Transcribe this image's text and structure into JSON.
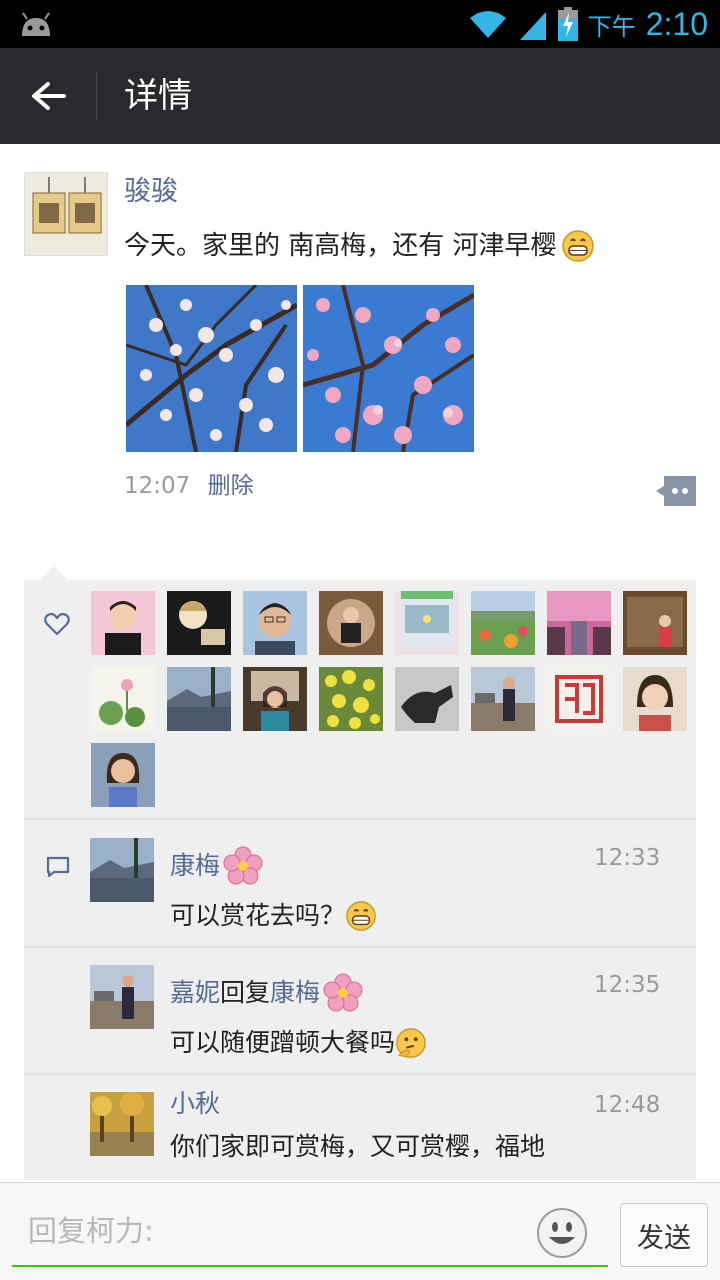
{
  "status_bar": {
    "ampm": "下午",
    "time": "2:10",
    "icons": [
      "android-icon",
      "wifi-icon",
      "signal-icon",
      "battery-charging-icon"
    ]
  },
  "action_bar": {
    "title": "详情",
    "back_icon": "arrow-left-icon"
  },
  "post": {
    "author": "骏骏",
    "text": "今天。家里的 南高梅，还有 河津早樱",
    "text_emoji": "grin-emoji",
    "time": "12:07",
    "delete_label": "删除",
    "photos": [
      "plum-blossom-photo",
      "cherry-blossom-photo"
    ],
    "comment_icon": "comment-dots-icon"
  },
  "likes": {
    "icon": "heart-icon",
    "avatars": [
      "avatar-1",
      "avatar-2",
      "avatar-3",
      "avatar-4",
      "avatar-5",
      "avatar-6",
      "avatar-7",
      "avatar-8",
      "avatar-9",
      "avatar-10",
      "avatar-11",
      "avatar-12",
      "avatar-13",
      "avatar-14",
      "avatar-15",
      "avatar-16",
      "avatar-17"
    ]
  },
  "comments": [
    {
      "name": "康梅",
      "name_emoji": "flower-emoji",
      "time": "12:33",
      "text": "可以赏花去吗？",
      "text_emoji": "grin-emoji"
    },
    {
      "name": "嘉妮",
      "reply_word": "回复",
      "reply_to": "康梅",
      "reply_to_emoji": "flower-emoji",
      "time": "12:35",
      "text": "可以随便蹭顿大餐吗",
      "text_emoji": "thinking-emoji"
    },
    {
      "name": "小秋",
      "time": "12:48",
      "text": "你们家即可赏梅，又可赏樱，福地"
    }
  ],
  "reply_bar": {
    "placeholder": "回复柯力:",
    "send_label": "发送",
    "emoji_icon": "smiley-icon"
  },
  "colors": {
    "accent_link": "#576b95",
    "input_underline": "#45c01a",
    "status_blue": "#33b5e5",
    "actionbar_bg": "#282a2d"
  }
}
